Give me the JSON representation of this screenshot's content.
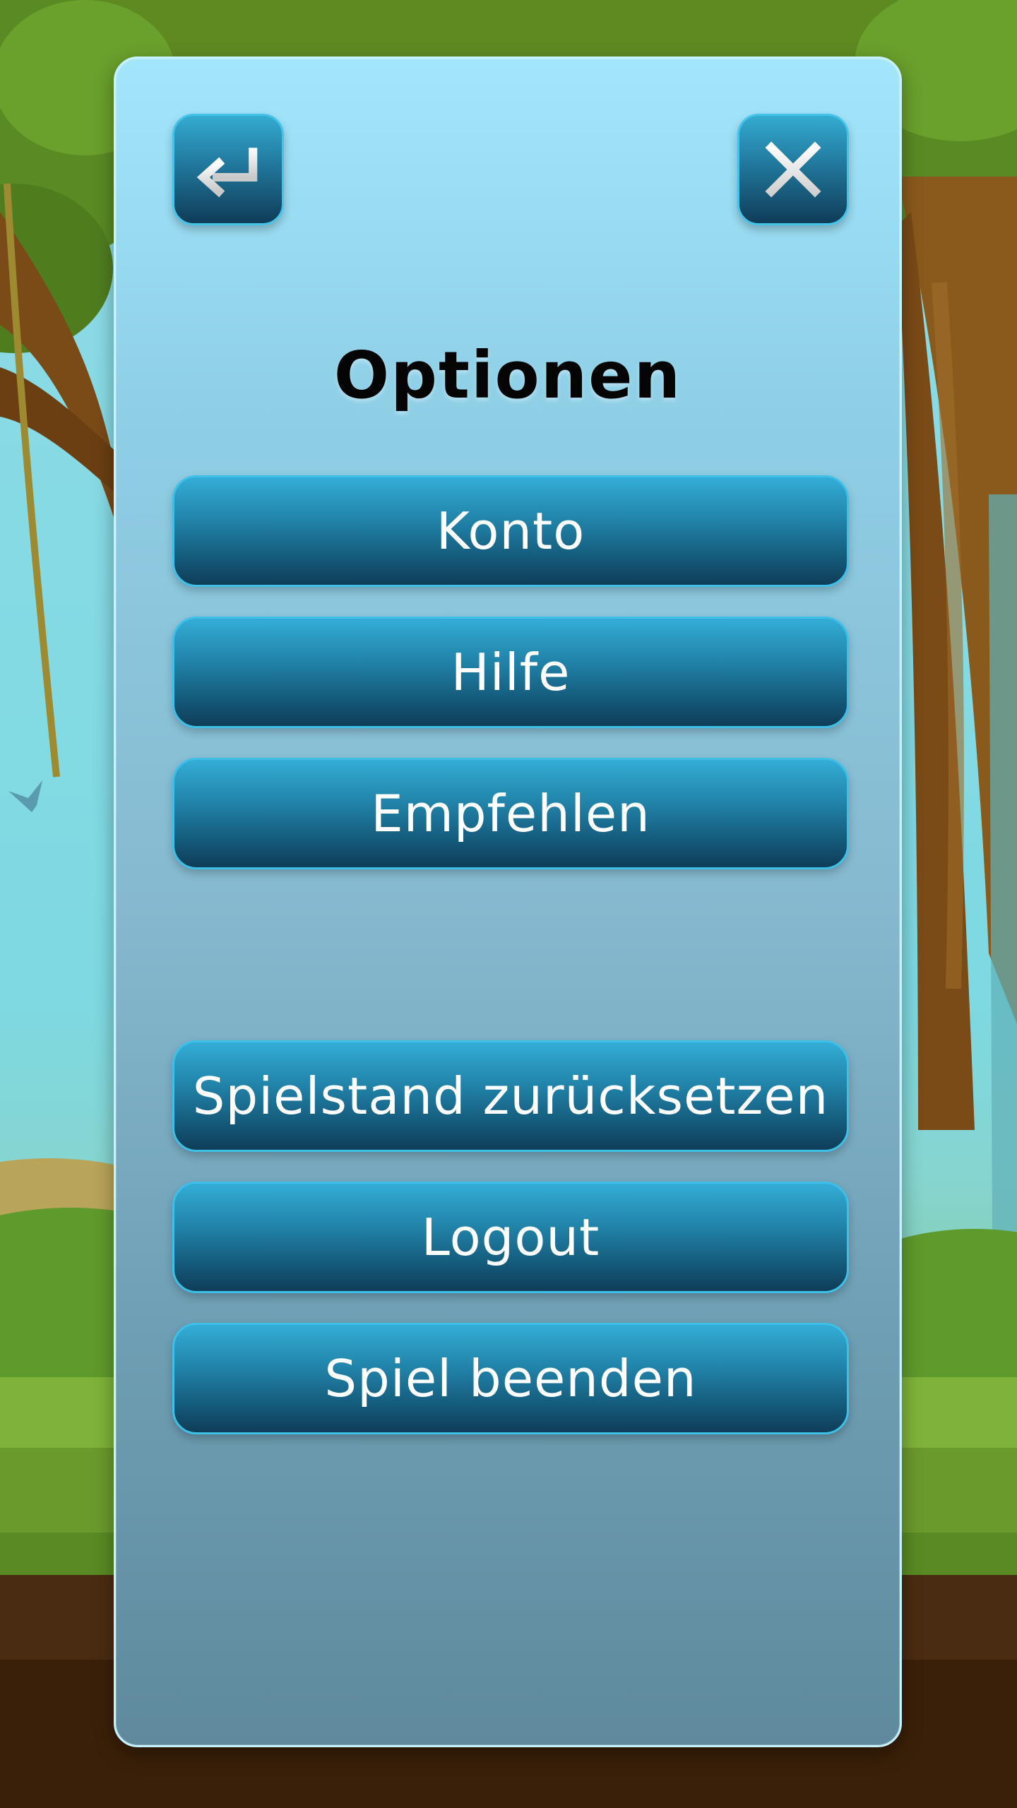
{
  "dialog": {
    "title": "Optionen",
    "back_icon": "return-arrow-icon",
    "close_icon": "close-x-icon"
  },
  "menu": {
    "primary": [
      {
        "label": "Konto"
      },
      {
        "label": "Hilfe"
      },
      {
        "label": "Empfehlen"
      }
    ],
    "secondary": [
      {
        "label": "Spielstand zurücksetzen"
      },
      {
        "label": "Logout"
      },
      {
        "label": "Spiel beenden"
      }
    ]
  },
  "colors": {
    "button_top": "#33add6",
    "button_bottom": "#0f3d57",
    "panel_top": "#a3e6fc",
    "panel_bottom": "#5f8a9d",
    "title": "#050505",
    "label": "#ffffff"
  }
}
